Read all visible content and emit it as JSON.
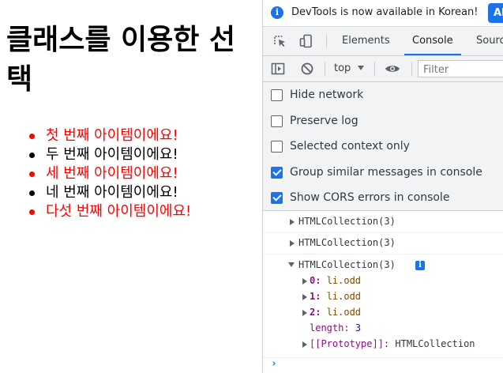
{
  "page": {
    "title": "클래스를 이용한 선택",
    "items": [
      {
        "text": "첫 번째 아이템이에요!",
        "class": "odd"
      },
      {
        "text": "두 번째 아이템이에요!",
        "class": "even"
      },
      {
        "text": "세 번째 아이템이에요!",
        "class": "odd"
      },
      {
        "text": "네 번째 아이템이에요!",
        "class": "even"
      },
      {
        "text": "다섯 번째 아이템이에요!",
        "class": "odd"
      }
    ]
  },
  "devtools": {
    "infobar": {
      "message": "DevTools is now available in Korean!",
      "button_label": "Alw"
    },
    "tabs": {
      "elements": "Elements",
      "console": "Console",
      "sources": "Sourc"
    },
    "toolbar": {
      "context": "top",
      "filter_placeholder": "Filter"
    },
    "settings": [
      {
        "label": "Hide network",
        "checked": false
      },
      {
        "label": "Preserve log",
        "checked": false
      },
      {
        "label": "Selected context only",
        "checked": false
      },
      {
        "label": "Group similar messages in console",
        "checked": true
      },
      {
        "label": "Show CORS errors in console",
        "checked": true
      }
    ],
    "console": {
      "messages": [
        "HTMLCollection(3)",
        "HTMLCollection(3)",
        "HTMLCollection(3)"
      ],
      "info_badge": "i",
      "entries": [
        {
          "key": "0",
          "value": "li.odd"
        },
        {
          "key": "1",
          "value": "li.odd"
        },
        {
          "key": "2",
          "value": "li.odd"
        }
      ],
      "length_key": "length",
      "length_value": "3",
      "prototype_key": "[[Prototype]]",
      "prototype_value": "HTMLCollection",
      "prompt": "›"
    }
  },
  "colors": {
    "odd_item": "#ff0000",
    "accent": "#1a73e8",
    "property_key": "#881280",
    "string_value": "#7a4d00",
    "number_value": "#1a1aa6"
  },
  "icons": [
    "inspect-element-icon",
    "device-toggle-icon",
    "sidebar-toggle-icon",
    "clear-console-icon",
    "eye-icon",
    "info-icon"
  ]
}
